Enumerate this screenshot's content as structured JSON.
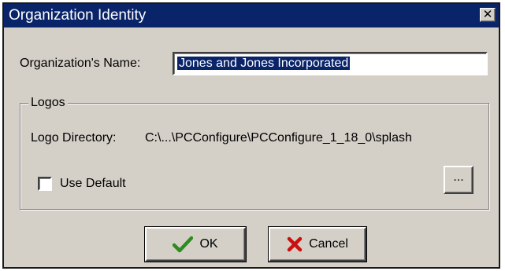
{
  "window": {
    "title": "Organization Identity",
    "close_glyph": "✕",
    "title_bar_color": "#0a246a",
    "face_color": "#d4d0c8"
  },
  "organization": {
    "name_label": "Organization's Name:",
    "name_value": "Jones and Jones Incorporated"
  },
  "logos": {
    "group_label": "Logos",
    "directory_label": "Logo Directory:",
    "directory_value": "C:\\...\\PCConfigure\\PCConfigure_1_18_0\\splash",
    "use_default_label": "Use Default",
    "use_default_checked": false,
    "browse_label": "..."
  },
  "buttons": {
    "ok_label": "OK",
    "ok_icon": "checkmark-icon",
    "ok_icon_color": "#2e8b20",
    "cancel_label": "Cancel",
    "cancel_icon": "x-icon",
    "cancel_icon_color": "#cc1010"
  }
}
